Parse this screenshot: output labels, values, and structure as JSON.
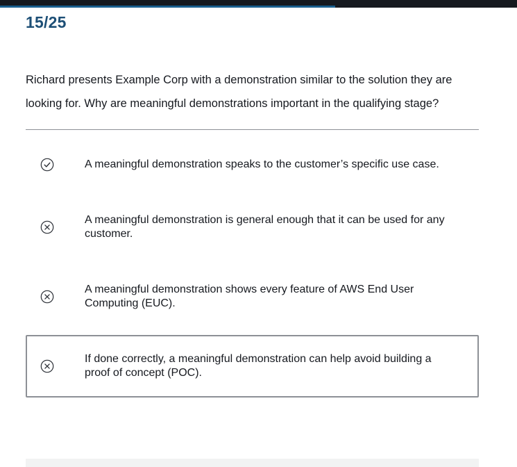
{
  "progress": {
    "fraction": 0.648
  },
  "counter": "15/25",
  "question": "Richard presents Example Corp with a demonstration similar to the solution they are looking for. Why are meaningful demonstrations important in the qualifying stage?",
  "options": [
    {
      "icon": "check-circle-icon",
      "text": "A meaningful demonstration speaks to the customer’s specific use case.",
      "selected": false
    },
    {
      "icon": "x-circle-icon",
      "text": "A meaningful demonstration is general enough that it can be used for any customer.",
      "selected": false
    },
    {
      "icon": "x-circle-icon",
      "text": "A meaningful demonstration shows every feature of AWS End User Computing (EUC).",
      "selected": false
    },
    {
      "icon": "x-circle-icon",
      "text": "If done correctly, a meaningful demonstration can help avoid building a proof of concept (POC).",
      "selected": true
    }
  ],
  "colors": {
    "accent": "#1b5f8e",
    "counter": "#1d4f76",
    "border": "#8d9096",
    "text": "#16191f"
  }
}
